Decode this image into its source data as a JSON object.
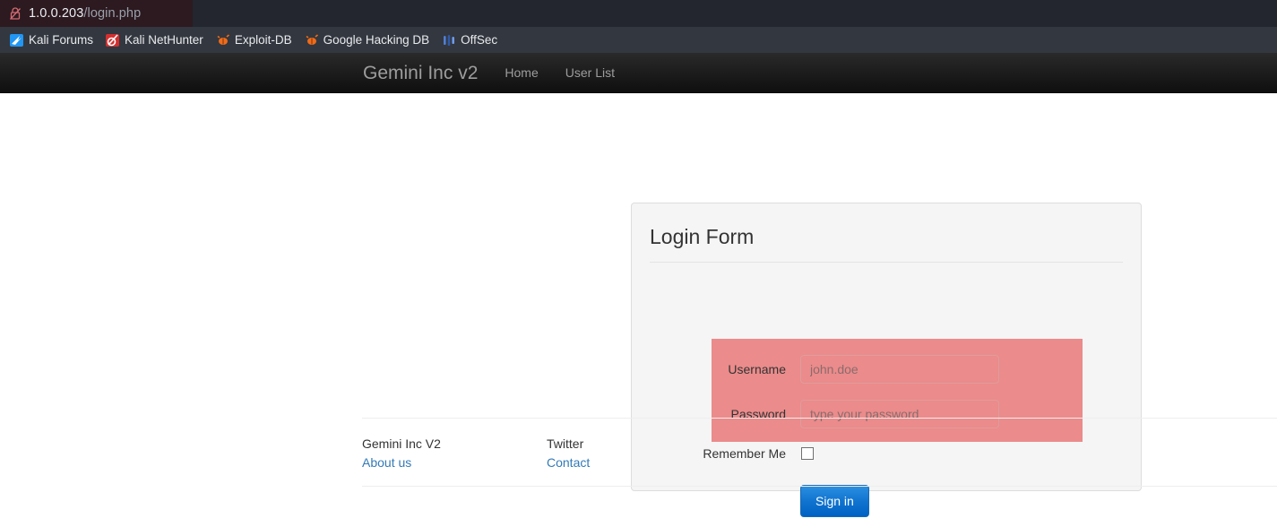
{
  "browser": {
    "tab": {
      "security_icon": "insecure-lock-icon",
      "url_host": "1.0.0.203",
      "url_path": "/login.php"
    },
    "bookmarks": [
      {
        "label": "Kali Forums",
        "icon": "kali-dragon-icon"
      },
      {
        "label": "Kali NetHunter",
        "icon": "kali-nethunter-icon"
      },
      {
        "label": "Exploit-DB",
        "icon": "exploit-db-icon"
      },
      {
        "label": "Google Hacking DB",
        "icon": "google-hacking-db-icon"
      },
      {
        "label": "OffSec",
        "icon": "offsec-icon"
      }
    ]
  },
  "navbar": {
    "brand": "Gemini Inc v2",
    "links": [
      {
        "label": "Home"
      },
      {
        "label": "User List"
      }
    ]
  },
  "login_panel": {
    "title": "Login Form",
    "username": {
      "label": "Username",
      "placeholder": "john.doe",
      "value": ""
    },
    "password": {
      "label": "Password",
      "placeholder": "type your password",
      "value": ""
    },
    "remember": {
      "label": "Remember Me",
      "checked": false
    },
    "submit_label": "Sign in",
    "highlight_color": "#eb8b8b"
  },
  "footer": {
    "columns": [
      {
        "heading": "Gemini Inc V2",
        "link": "About us"
      },
      {
        "heading": "Twitter",
        "link": "Contact"
      }
    ]
  },
  "colors": {
    "accent_blue": "#0061c3",
    "link_blue": "#337ab7",
    "navbar_dark": "#1b1b1b",
    "panel_bg": "#f5f5f5",
    "highlight_pink": "#eb8b8b"
  }
}
